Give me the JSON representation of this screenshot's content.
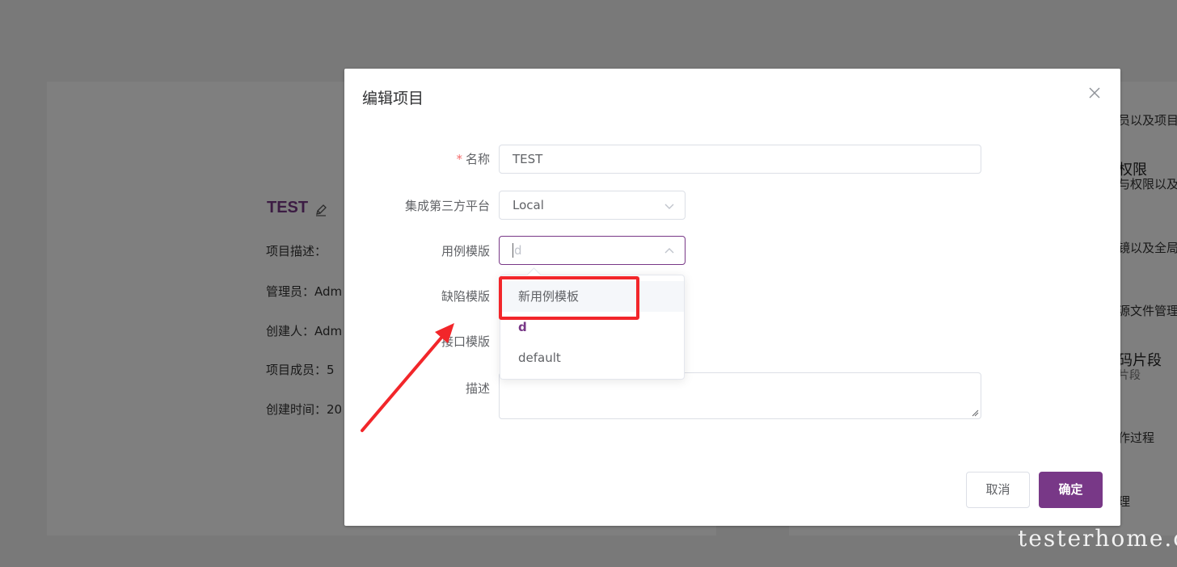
{
  "background": {
    "project_name": "TEST",
    "info_rows": [
      {
        "label": "项目描述：",
        "value": ""
      },
      {
        "label": "管理员：",
        "value": "Adm"
      },
      {
        "label": "创建人：",
        "value": "Adm"
      },
      {
        "label": "项目成员：",
        "value": "5"
      },
      {
        "label": "创建时间：",
        "value": "20"
      }
    ],
    "side_texts": [
      "员以及项目",
      "权限",
      "与权限以及",
      "镜以及全局",
      "源文件管理",
      "码片段",
      "片段",
      "作过程",
      "理"
    ]
  },
  "dialog": {
    "title": "编辑项目",
    "fields": {
      "name": {
        "label": "名称",
        "required_mark": "*",
        "value": "TEST"
      },
      "platform": {
        "label": "集成第三方平台",
        "value": "Local"
      },
      "case_template": {
        "label": "用例模版",
        "value": "d"
      },
      "defect_template": {
        "label": "缺陷模版"
      },
      "api_template": {
        "label": "接口模版",
        "visible_label": "接口模版"
      },
      "description": {
        "label": "描述",
        "value": ""
      }
    },
    "dropdown_options": [
      {
        "label": "新用例模板",
        "state": "hover"
      },
      {
        "label": "d",
        "state": "selected"
      },
      {
        "label": "default",
        "state": "normal"
      }
    ],
    "buttons": {
      "cancel": "取消",
      "confirm": "确定"
    }
  },
  "colors": {
    "accent": "#783887",
    "annotation_red": "#f2262a"
  },
  "watermark": "testerhome.com"
}
